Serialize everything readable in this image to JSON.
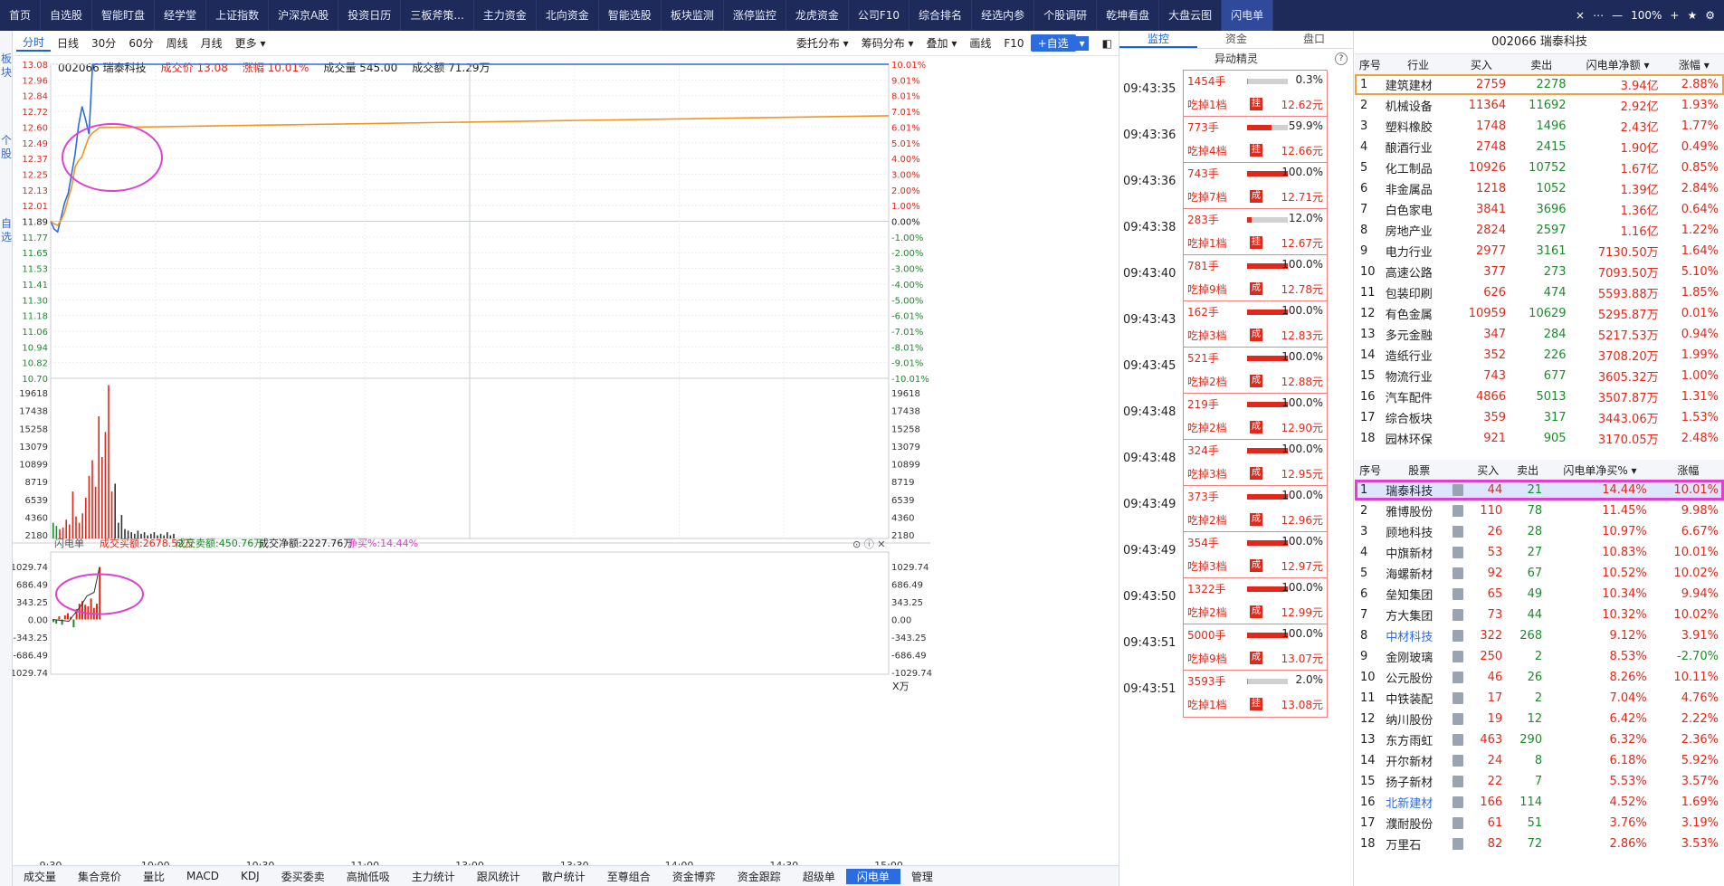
{
  "nav": {
    "items": [
      "首页",
      "自选股",
      "智能盯盘",
      "经学堂",
      "上证指数",
      "沪深京A股",
      "投资日历",
      "三板斧策...",
      "主力资金",
      "北向资金",
      "智能选股",
      "板块监测",
      "涨停监控",
      "龙虎资金",
      "公司F10",
      "综合排名",
      "经选内参",
      "个股调研",
      "乾坤看盘",
      "大盘云图",
      "闪电单"
    ],
    "active": "闪电单",
    "zoom": "100%"
  },
  "leftbar": {
    "t1": "板块",
    "t2": "个股",
    "t3": "自选"
  },
  "toolbar": {
    "left": [
      "分时",
      "日线",
      "30分",
      "60分",
      "周线",
      "月线",
      "更多"
    ],
    "selected": "分时",
    "right": [
      "委托分布",
      "筹码分布",
      "叠加",
      "画线",
      "F10"
    ],
    "zixuan": "+自选"
  },
  "stock": {
    "code_name": "002066 瑞泰科技",
    "price_label": "成交价",
    "price": "13.08",
    "chg_label": "涨幅",
    "chg": "10.01%",
    "vol_label": "成交量",
    "vol": "545.00",
    "amt_label": "成交额",
    "amt": "71.29万"
  },
  "price_axis": {
    "left": [
      "13.08",
      "12.96",
      "12.84",
      "12.72",
      "12.60",
      "12.49",
      "12.37",
      "12.25",
      "12.13",
      "12.01",
      "11.89",
      "11.77",
      "11.65",
      "11.53",
      "11.41",
      "11.30",
      "11.18",
      "11.06",
      "10.94",
      "10.82",
      "10.70"
    ],
    "right": [
      "10.01%",
      "9.01%",
      "8.01%",
      "7.01%",
      "6.01%",
      "5.01%",
      "4.00%",
      "3.00%",
      "2.00%",
      "1.00%",
      "0.00%",
      "-1.00%",
      "-2.00%",
      "-3.00%",
      "-4.00%",
      "-5.00%",
      "-6.01%",
      "-7.01%",
      "-8.01%",
      "-9.01%",
      "-10.01%"
    ]
  },
  "vol_axis": [
    "19618",
    "17438",
    "15258",
    "13079",
    "10899",
    "8719",
    "6539",
    "4360",
    "2180"
  ],
  "flash": {
    "label": "闪电单",
    "buy": "成交买额:2678.52万",
    "sell": "成交卖额:450.76万",
    "net": "成交净额:2227.76万",
    "pct": "净买%:14.44%",
    "axis": [
      "1029.74",
      "686.49",
      "343.25",
      "0.00",
      "-343.25",
      "-686.49",
      "-1029.74"
    ],
    "unit": "X万"
  },
  "time_axis": [
    "9:30",
    "10:00",
    "10:30",
    "11:00",
    "13:00",
    "13:30",
    "14:00",
    "14:30",
    "15:00"
  ],
  "chart_data": {
    "type": "line",
    "x": [
      "9:30",
      "9:31",
      "9:32",
      "9:33",
      "9:34",
      "9:35",
      "9:36",
      "9:37",
      "9:38",
      "9:39",
      "9:40",
      "9:41",
      "9:42",
      "9:43",
      "9:44",
      "15:00"
    ],
    "series": [
      {
        "values": [
          11.89,
          11.83,
          11.81,
          11.92,
          12.03,
          12.1,
          12.25,
          12.4,
          12.62,
          12.76,
          12.66,
          12.55,
          13.08,
          13.08,
          13.08,
          13.08
        ]
      },
      {
        "values": [
          11.89,
          11.87,
          11.86,
          11.9,
          11.96,
          12.06,
          12.15,
          12.3,
          12.35,
          12.38,
          12.46,
          12.53,
          12.56,
          12.58,
          12.6,
          12.69
        ]
      }
    ],
    "ylim": [
      10.7,
      13.08
    ]
  },
  "bottom_tabs": [
    "成交量",
    "集合竞价",
    "量比",
    "MACD",
    "KDJ",
    "委买委卖",
    "高抛低吸",
    "主力统计",
    "跟风统计",
    "散户统计",
    "至尊组合",
    "资金博弈",
    "资金跟踪",
    "超级单",
    "闪电单",
    "管理"
  ],
  "monitor": {
    "tabs": [
      "监控",
      "资金",
      "盘口"
    ],
    "active": "监控",
    "sub": "异动精灵",
    "items": [
      {
        "time": "09:43:35",
        "vol": "1454手",
        "pct": "0.3%",
        "desc": "吃掉1档",
        "tag": "挂",
        "price": "12.62元",
        "fill": 0.03,
        "color": "#999999"
      },
      {
        "time": "09:43:36",
        "vol": "773手",
        "pct": "59.9%",
        "desc": "吃掉4档",
        "tag": "挂",
        "price": "12.66元",
        "fill": 0.6,
        "color": "#e0291b"
      },
      {
        "time": "09:43:36",
        "vol": "743手",
        "pct": "100.0%",
        "desc": "吃掉7档",
        "tag": "成",
        "price": "12.71元",
        "fill": 1,
        "color": "#e0291b"
      },
      {
        "time": "09:43:38",
        "vol": "283手",
        "pct": "12.0%",
        "desc": "吃掉1档",
        "tag": "挂",
        "price": "12.67元",
        "fill": 0.12,
        "color": "#e0291b"
      },
      {
        "time": "09:43:40",
        "vol": "781手",
        "pct": "100.0%",
        "desc": "吃掉9档",
        "tag": "成",
        "price": "12.78元",
        "fill": 1,
        "color": "#e0291b"
      },
      {
        "time": "09:43:43",
        "vol": "162手",
        "pct": "100.0%",
        "desc": "吃掉3档",
        "tag": "成",
        "price": "12.83元",
        "fill": 1,
        "color": "#e0291b"
      },
      {
        "time": "09:43:45",
        "vol": "521手",
        "pct": "100.0%",
        "desc": "吃掉2档",
        "tag": "成",
        "price": "12.88元",
        "fill": 1,
        "color": "#e0291b"
      },
      {
        "time": "09:43:48",
        "vol": "219手",
        "pct": "100.0%",
        "desc": "吃掉2档",
        "tag": "成",
        "price": "12.90元",
        "fill": 1,
        "color": "#e0291b"
      },
      {
        "time": "09:43:48",
        "vol": "324手",
        "pct": "100.0%",
        "desc": "吃掉3档",
        "tag": "成",
        "price": "12.95元",
        "fill": 1,
        "color": "#e0291b"
      },
      {
        "time": "09:43:49",
        "vol": "373手",
        "pct": "100.0%",
        "desc": "吃掉2档",
        "tag": "成",
        "price": "12.96元",
        "fill": 1,
        "color": "#e0291b"
      },
      {
        "time": "09:43:49",
        "vol": "354手",
        "pct": "100.0%",
        "desc": "吃掉3档",
        "tag": "成",
        "price": "12.97元",
        "fill": 1,
        "color": "#e0291b"
      },
      {
        "time": "09:43:50",
        "vol": "1322手",
        "pct": "100.0%",
        "desc": "吃掉2档",
        "tag": "成",
        "price": "12.99元",
        "fill": 1,
        "color": "#e0291b"
      },
      {
        "time": "09:43:51",
        "vol": "5000手",
        "pct": "100.0%",
        "desc": "吃掉9档",
        "tag": "成",
        "price": "13.07元",
        "fill": 1,
        "color": "#e0291b"
      },
      {
        "time": "09:43:51",
        "vol": "3593手",
        "pct": "2.0%",
        "desc": "吃掉1档",
        "tag": "挂",
        "price": "13.08元",
        "fill": 0.02,
        "color": "#999999"
      }
    ]
  },
  "rp": {
    "title": "002066 瑞泰科技",
    "ind_head": [
      "序号",
      "行业",
      "买入",
      "卖出",
      "闪电单净额",
      "涨幅"
    ],
    "industries": [
      [
        "1",
        "建筑建材",
        "2759",
        "2278",
        "3.94亿",
        "2.88%"
      ],
      [
        "2",
        "机械设备",
        "11364",
        "11692",
        "2.92亿",
        "1.93%"
      ],
      [
        "3",
        "塑料橡胶",
        "1748",
        "1496",
        "2.43亿",
        "1.77%"
      ],
      [
        "4",
        "酿酒行业",
        "2748",
        "2415",
        "1.90亿",
        "0.49%"
      ],
      [
        "5",
        "化工制品",
        "10926",
        "10752",
        "1.67亿",
        "0.85%"
      ],
      [
        "6",
        "非金属品",
        "1218",
        "1052",
        "1.39亿",
        "2.84%"
      ],
      [
        "7",
        "白色家电",
        "3841",
        "3696",
        "1.36亿",
        "0.64%"
      ],
      [
        "8",
        "房地产业",
        "2824",
        "2597",
        "1.16亿",
        "1.22%"
      ],
      [
        "9",
        "电力行业",
        "2977",
        "3161",
        "7130.50万",
        "1.64%"
      ],
      [
        "10",
        "高速公路",
        "377",
        "273",
        "7093.50万",
        "5.10%"
      ],
      [
        "11",
        "包装印刷",
        "626",
        "474",
        "5593.88万",
        "1.85%"
      ],
      [
        "12",
        "有色金属",
        "10959",
        "10629",
        "5295.87万",
        "0.01%"
      ],
      [
        "13",
        "多元金融",
        "347",
        "284",
        "5217.53万",
        "0.94%"
      ],
      [
        "14",
        "造纸行业",
        "352",
        "226",
        "3708.20万",
        "1.99%"
      ],
      [
        "15",
        "物流行业",
        "743",
        "677",
        "3605.32万",
        "1.00%"
      ],
      [
        "16",
        "汽车配件",
        "4866",
        "5013",
        "3507.87万",
        "1.31%"
      ],
      [
        "17",
        "综合板块",
        "359",
        "317",
        "3443.06万",
        "1.53%"
      ],
      [
        "18",
        "园林环保",
        "921",
        "905",
        "3170.05万",
        "2.48%"
      ]
    ],
    "stk_head": [
      "序号",
      "股票",
      "",
      "买入",
      "卖出",
      "闪电单净买%",
      "涨幅"
    ],
    "stocks": [
      [
        "1",
        "瑞泰科技",
        "44",
        "21",
        "14.44%",
        "10.01%"
      ],
      [
        "2",
        "雅博股份",
        "110",
        "78",
        "11.45%",
        "9.98%"
      ],
      [
        "3",
        "顾地科技",
        "26",
        "28",
        "10.97%",
        "6.67%"
      ],
      [
        "4",
        "中旗新材",
        "53",
        "27",
        "10.83%",
        "10.01%"
      ],
      [
        "5",
        "海螺新材",
        "92",
        "67",
        "10.52%",
        "10.02%"
      ],
      [
        "6",
        "垒知集团",
        "65",
        "49",
        "10.34%",
        "9.94%"
      ],
      [
        "7",
        "方大集团",
        "73",
        "44",
        "10.32%",
        "10.02%"
      ],
      [
        "8",
        "中材科技",
        "322",
        "268",
        "9.12%",
        "3.91%"
      ],
      [
        "9",
        "金刚玻璃",
        "250",
        "2",
        "8.53%",
        "-2.70%"
      ],
      [
        "10",
        "公元股份",
        "46",
        "26",
        "8.26%",
        "10.11%"
      ],
      [
        "11",
        "中铁装配",
        "17",
        "2",
        "7.04%",
        "4.76%"
      ],
      [
        "12",
        "纳川股份",
        "19",
        "12",
        "6.42%",
        "2.22%"
      ],
      [
        "13",
        "东方雨虹",
        "463",
        "290",
        "6.32%",
        "2.36%"
      ],
      [
        "14",
        "开尔新材",
        "24",
        "8",
        "6.18%",
        "5.92%"
      ],
      [
        "15",
        "扬子新材",
        "22",
        "7",
        "5.53%",
        "3.57%"
      ],
      [
        "16",
        "北新建材",
        "166",
        "114",
        "4.52%",
        "1.69%"
      ],
      [
        "17",
        "濮耐股份",
        "61",
        "51",
        "3.76%",
        "3.19%"
      ],
      [
        "18",
        "万里石",
        "82",
        "72",
        "2.86%",
        "3.53%"
      ]
    ]
  }
}
